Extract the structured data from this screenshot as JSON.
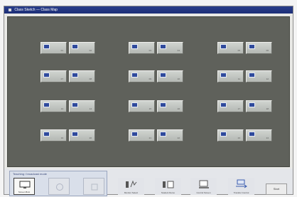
{
  "window": {
    "title": "Class Sketch — Class Map"
  },
  "room": {
    "tiles": [
      {
        "label": "01"
      },
      {
        "label": "02"
      },
      {
        "label": "03"
      },
      {
        "label": "04"
      },
      {
        "label": "05"
      },
      {
        "label": "06"
      },
      {
        "label": "07"
      },
      {
        "label": "08"
      },
      {
        "label": "09"
      },
      {
        "label": "10"
      },
      {
        "label": "11"
      },
      {
        "label": "12"
      },
      {
        "label": "13"
      },
      {
        "label": "14"
      },
      {
        "label": "15"
      },
      {
        "label": "16"
      },
      {
        "label": "17"
      },
      {
        "label": "18"
      },
      {
        "label": "19"
      },
      {
        "label": "20"
      },
      {
        "label": "21"
      },
      {
        "label": "22"
      },
      {
        "label": "23"
      },
      {
        "label": "24"
      }
    ]
  },
  "toolbar": {
    "group_label": "Teaching / broadcast mode",
    "mode_buttons": [
      {
        "label": "Screen Bcst",
        "selected": true
      },
      {
        "label": "",
        "selected": false
      },
      {
        "label": "",
        "selected": false
      }
    ],
    "tools": [
      {
        "label": "Monitor Select",
        "icon": "monitor-select-icon"
      },
      {
        "label": "Student Demo",
        "icon": "student-demo-icon"
      },
      {
        "label": "Control Screen",
        "icon": "control-screen-icon"
      },
      {
        "label": "Transfer Control",
        "icon": "transfer-control-icon"
      }
    ],
    "start_label": "Start"
  },
  "colors": {
    "room_bg": "#5f615b",
    "tile_bg": "#c4c8c4",
    "tile_monitor": "#2f4a9c",
    "titlebar": "#1d2f78"
  }
}
